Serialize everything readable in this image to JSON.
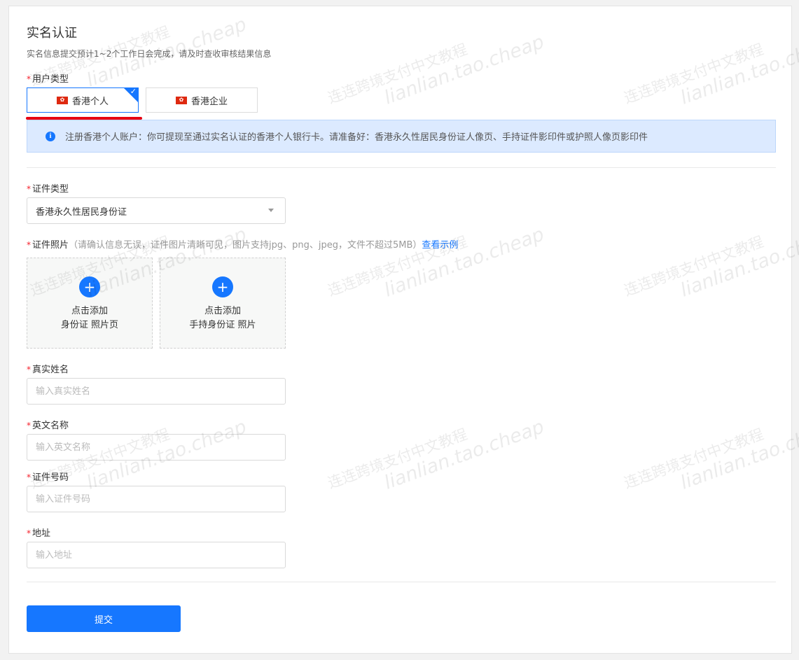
{
  "page": {
    "title": "实名认证",
    "subtitle": "实名信息提交预计1~2个工作日会完成，请及时查收审核结果信息"
  },
  "user_type": {
    "label": "用户类型",
    "options": [
      {
        "label": "香港个人",
        "selected": true
      },
      {
        "label": "香港企业",
        "selected": false
      }
    ],
    "flag_glyph": "✿"
  },
  "notice": {
    "icon": "info-icon",
    "icon_glyph": "i",
    "text": "注册香港个人账户：你可提现至通过实名认证的香港个人银行卡。请准备好：香港永久性居民身份证人像页、手持证件影印件或护照人像页影印件"
  },
  "id_type": {
    "label": "证件类型",
    "value": "香港永久性居民身份证"
  },
  "id_photo": {
    "label": "证件照片",
    "hint": "（请确认信息无误，证件图片清晰可见，图片支持jpg、png、jpeg，文件不超过5MB）",
    "link": "查看示例",
    "uploads": [
      {
        "line1": "点击添加",
        "line2": "身份证 照片页"
      },
      {
        "line1": "点击添加",
        "line2": "手持身份证 照片"
      }
    ]
  },
  "fields": {
    "real_name": {
      "label": "真实姓名",
      "placeholder": "输入真实姓名"
    },
    "english_name": {
      "label": "英文名称",
      "placeholder": "输入英文名称"
    },
    "id_number": {
      "label": "证件号码",
      "placeholder": "输入证件号码"
    },
    "address": {
      "label": "地址",
      "placeholder": "输入地址"
    }
  },
  "required_mark": "*",
  "submit_label": "提交",
  "watermark": {
    "cn": "连连跨境支付中文教程",
    "en": "lianlian.tao.cheap"
  },
  "colors": {
    "primary": "#1677ff",
    "required": "#f5222d",
    "notice_bg": "#dceaff",
    "highlight_underline": "#e60012"
  }
}
